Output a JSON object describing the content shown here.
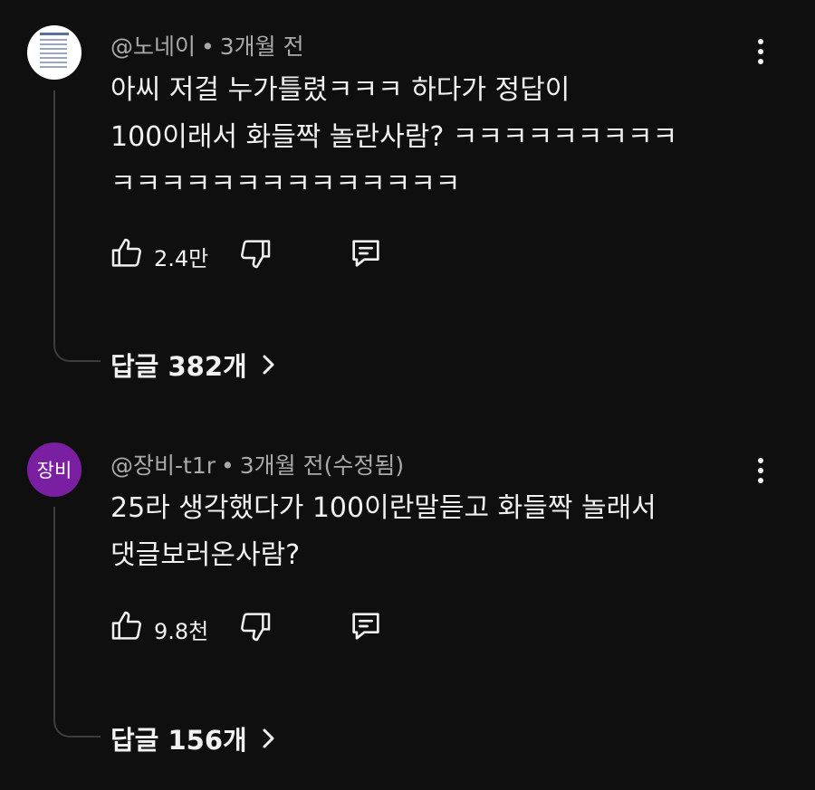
{
  "comments": [
    {
      "author": "@노네이",
      "separator": "•",
      "time": "3개월 전",
      "avatar_icon": "document-thumbnail",
      "text": "아씨 저걸 누가틀렸ㅋㅋㅋ 하다가 정답이\n100이래서 화들짝 놀란사람? ㅋㅋㅋㅋㅋㅋㅋㅋㅋ\nㅋㅋㅋㅋㅋㅋㅋㅋㅋㅋㅋㅋㅋㅋ",
      "likes": "2.4만",
      "replies_label": "답글 382개"
    },
    {
      "author": "@장비-t1r",
      "separator": "•",
      "time": "3개월 전(수정됨)",
      "avatar_text": "장비",
      "avatar_color": "#7a1fa2",
      "text": "25라 생각했다가 100이란말듣고 화들짝 놀래서\n댓글보러온사람?",
      "likes": "9.8천",
      "replies_label": "답글 156개"
    }
  ],
  "colors": {
    "background": "#0f0f0f",
    "text": "#f1f1f1",
    "meta": "#aaaaaa",
    "thread_line": "#3d3d3d"
  },
  "icons": [
    "like-icon",
    "dislike-icon",
    "reply-icon",
    "more-vert-icon",
    "chevron-right-icon"
  ]
}
